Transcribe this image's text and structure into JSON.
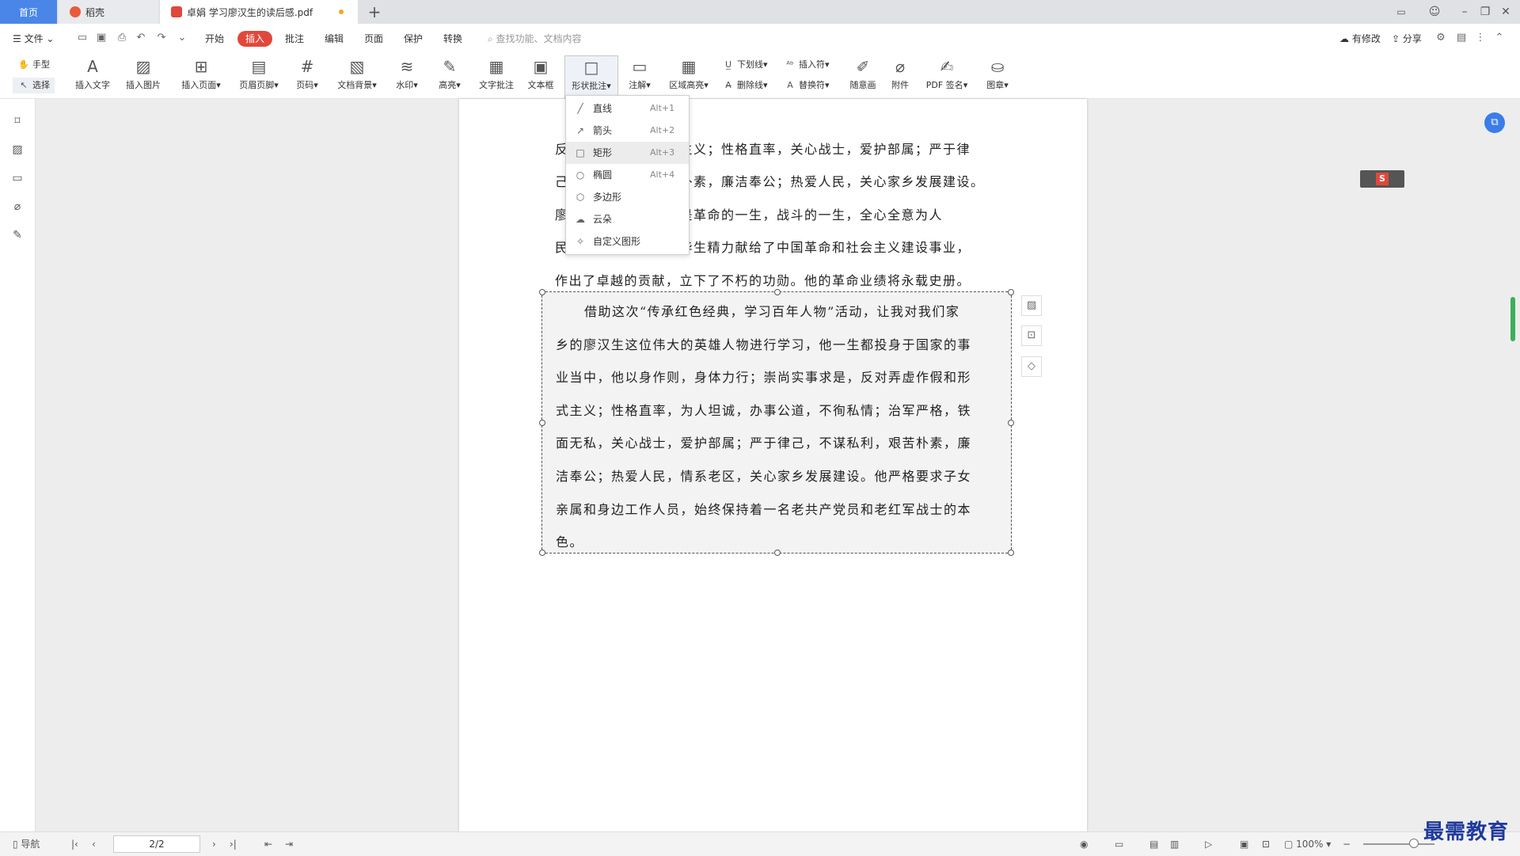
{
  "tabs": [
    {
      "label": "首页"
    },
    {
      "label": "稻壳"
    },
    {
      "label": "卓娟 学习廖汉生的读后感.pdf"
    }
  ],
  "window": {
    "minimize": "–",
    "restore": "❐",
    "close": "✕",
    "newtab": "+"
  },
  "menubar": {
    "file": "文件",
    "items": [
      "开始",
      "插入",
      "批注",
      "编辑",
      "页面",
      "保护",
      "转换"
    ],
    "search_placeholder": "查找功能、文档内容",
    "right": {
      "modified": "有修改",
      "share": "分享"
    }
  },
  "ribbon": {
    "hand": "手型",
    "select": "选择",
    "buttons": [
      "插入文字",
      "插入图片",
      "插入页面",
      "页眉页脚",
      "页码",
      "文档背景",
      "水印",
      "高亮",
      "文字批注",
      "文本框",
      "形状批注",
      "注解",
      "区域高亮"
    ],
    "small": {
      "underline": "下划线",
      "strike": "删除线",
      "insert_sym": "插入符",
      "replace_sym": "替换符"
    },
    "buttons2": [
      "随意画",
      "附件",
      "PDF 签名",
      "图章"
    ]
  },
  "shape_menu": [
    {
      "label": "直线",
      "key": "Alt+1"
    },
    {
      "label": "箭头",
      "key": "Alt+2"
    },
    {
      "label": "矩形",
      "key": "Alt+3"
    },
    {
      "label": "椭圆",
      "key": "Alt+4"
    },
    {
      "label": "多边形",
      "key": ""
    },
    {
      "label": "云朵",
      "key": ""
    },
    {
      "label": "自定义图形",
      "key": ""
    }
  ],
  "doc": {
    "lines_before": [
      "反对弄虚作假和形式主义；性格直率，关心战士，爱护部属；严于律",
      "己，不谋私利，艰苦朴素，廉洁奉公；热爱人民，关心家乡发展建设。",
      "廖汉生同志的一生，是革命的一生，战斗的一生，全心全意为人",
      "民服务的一生，他把毕生精力献给了中国革命和社会主义建设事业，",
      "作出了卓越的贡献，立下了不朽的功勋。他的革命业绩将永载史册。"
    ],
    "textbox_lines": [
      "借助这次“传承红色经典，学习百年人物”活动，让我对我们家",
      "乡的廖汉生这位伟大的英雄人物进行学习，他一生都投身于国家的事",
      "业当中，他以身作则，身体力行；崇尚实事求是，反对弄虚作假和形",
      "式主义；性格直率，为人坦诚，办事公道，不徇私情；治军严格，铁",
      "面无私，关心战士，爱护部属；严于律己，不谋私利，艰苦朴素，廉",
      "洁奉公；热爱人民，情系老区，关心家乡发展建设。他严格要求子女",
      "亲属和身边工作人员，始终保持着一名老共产党员和老红军战士的本",
      "色。"
    ]
  },
  "status": {
    "nav": "导航",
    "page": "2/2",
    "zoom": "100%"
  },
  "watermark": "最需教育",
  "ime": "S"
}
